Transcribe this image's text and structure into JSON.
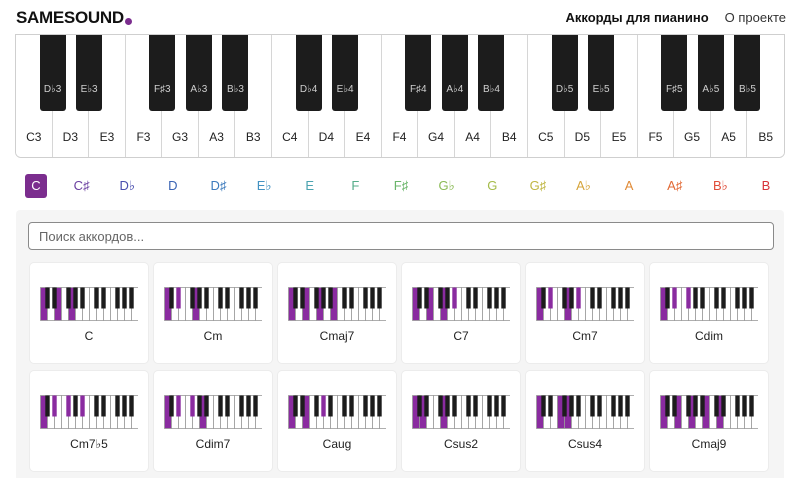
{
  "header": {
    "logo": "SAMESOUND",
    "nav": [
      {
        "label": "Аккорды для пианино",
        "active": true
      },
      {
        "label": "О проекте",
        "active": false
      }
    ]
  },
  "piano": {
    "white_keys": [
      "C3",
      "D3",
      "E3",
      "F3",
      "G3",
      "A3",
      "B3",
      "C4",
      "D4",
      "E4",
      "F4",
      "G4",
      "A4",
      "B4",
      "C5",
      "D5",
      "E5",
      "F5",
      "G5",
      "A5",
      "B5"
    ],
    "black_keys": [
      {
        "label": "D♭3",
        "after": 0
      },
      {
        "label": "E♭3",
        "after": 1
      },
      {
        "label": "F♯3",
        "after": 3
      },
      {
        "label": "A♭3",
        "after": 4
      },
      {
        "label": "B♭3",
        "after": 5
      },
      {
        "label": "D♭4",
        "after": 7
      },
      {
        "label": "E♭4",
        "after": 8
      },
      {
        "label": "F♯4",
        "after": 10
      },
      {
        "label": "A♭4",
        "after": 11
      },
      {
        "label": "B♭4",
        "after": 12
      },
      {
        "label": "D♭5",
        "after": 14
      },
      {
        "label": "E♭5",
        "after": 15
      },
      {
        "label": "F♯5",
        "after": 17
      },
      {
        "label": "A♭5",
        "after": 18
      },
      {
        "label": "B♭5",
        "after": 19
      }
    ]
  },
  "roots": {
    "selected": "C",
    "items": [
      {
        "label": "C",
        "color": "#7b2d8e"
      },
      {
        "label": "C♯",
        "color": "#6a3fa0"
      },
      {
        "label": "D♭",
        "color": "#4a4fae"
      },
      {
        "label": "D",
        "color": "#3a64b4"
      },
      {
        "label": "D♯",
        "color": "#3d7bbd"
      },
      {
        "label": "E♭",
        "color": "#4292c2"
      },
      {
        "label": "E",
        "color": "#4aa3b0"
      },
      {
        "label": "F",
        "color": "#56ad8a"
      },
      {
        "label": "F♯",
        "color": "#6ab56a"
      },
      {
        "label": "G♭",
        "color": "#8bbb56"
      },
      {
        "label": "G",
        "color": "#a5bc4a"
      },
      {
        "label": "G♯",
        "color": "#c0b642"
      },
      {
        "label": "A♭",
        "color": "#d6a43a"
      },
      {
        "label": "A",
        "color": "#e08a36"
      },
      {
        "label": "A♯",
        "color": "#e26a36"
      },
      {
        "label": "B♭",
        "color": "#e04c38"
      },
      {
        "label": "B",
        "color": "#d8343a"
      }
    ]
  },
  "search": {
    "placeholder": "Поиск аккордов...",
    "value": ""
  },
  "highlight_color": "#8a2ba0",
  "chords": [
    {
      "name": "C",
      "notes": [
        0,
        4,
        7
      ]
    },
    {
      "name": "Cm",
      "notes": [
        0,
        3,
        7
      ]
    },
    {
      "name": "Cmaj7",
      "notes": [
        0,
        4,
        7,
        11
      ]
    },
    {
      "name": "C7",
      "notes": [
        0,
        4,
        7,
        10
      ]
    },
    {
      "name": "Cm7",
      "notes": [
        0,
        3,
        7,
        10
      ]
    },
    {
      "name": "Cdim",
      "notes": [
        0,
        3,
        6
      ]
    },
    {
      "name": "Cm7♭5",
      "notes": [
        0,
        3,
        6,
        10
      ]
    },
    {
      "name": "Cdim7",
      "notes": [
        0,
        3,
        6,
        9
      ]
    },
    {
      "name": "Caug",
      "notes": [
        0,
        4,
        8
      ]
    },
    {
      "name": "Csus2",
      "notes": [
        0,
        2,
        7
      ]
    },
    {
      "name": "Csus4",
      "notes": [
        0,
        5,
        7
      ]
    },
    {
      "name": "Cmaj9",
      "notes": [
        0,
        4,
        7,
        11,
        14
      ]
    }
  ]
}
